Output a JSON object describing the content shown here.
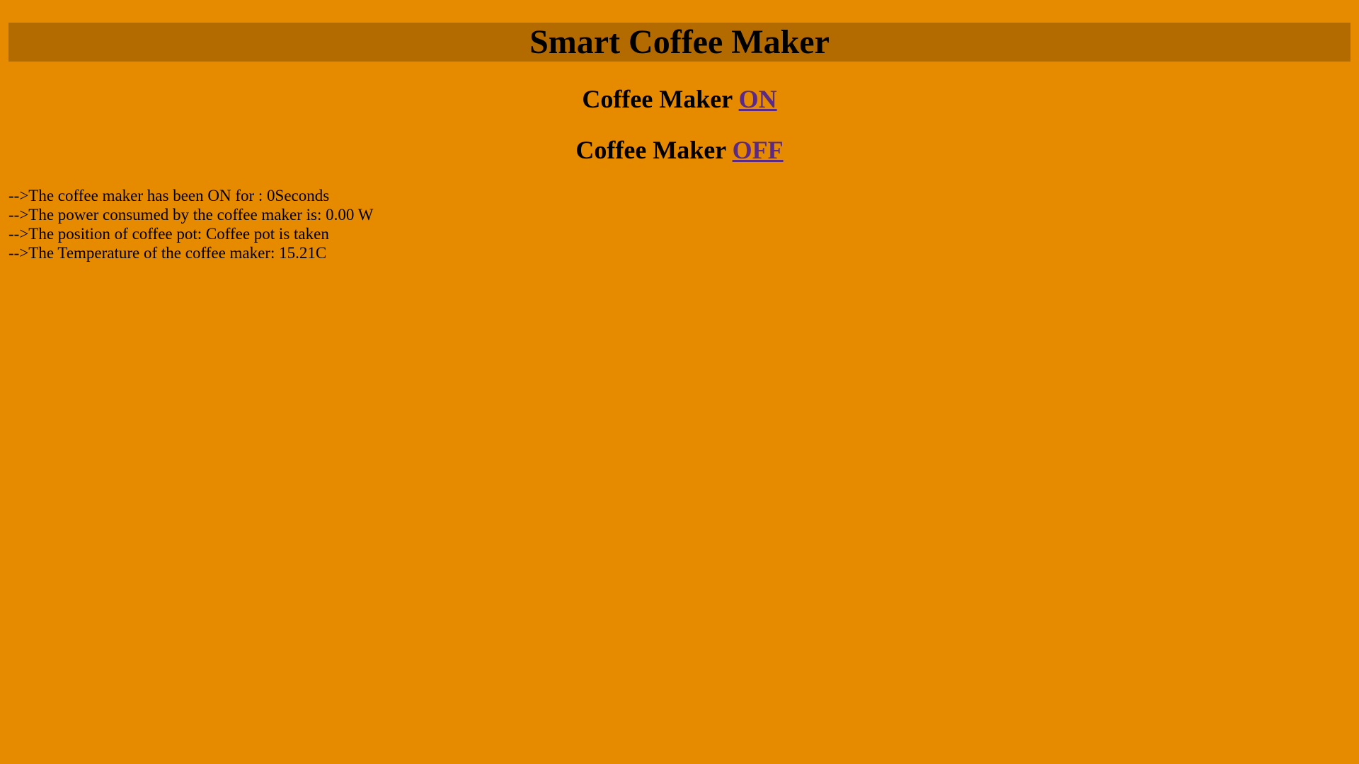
{
  "page": {
    "title": "Smart Coffee Maker",
    "background_color": "#e68a00",
    "title_bar_color": "#b36b00",
    "link_color": "#5b2a86"
  },
  "controls": {
    "on": {
      "label": "Coffee Maker ",
      "link": "ON"
    },
    "off": {
      "label": "Coffee Maker ",
      "link": "OFF"
    }
  },
  "status": {
    "uptime": "-->The coffee maker has been ON for : 0Seconds",
    "power": "-->The power consumed by the coffee maker is: 0.00 W",
    "pot_position": "-->The position of coffee pot: Coffee pot is taken",
    "temperature": "-->The Temperature of the coffee maker: 15.21C"
  }
}
